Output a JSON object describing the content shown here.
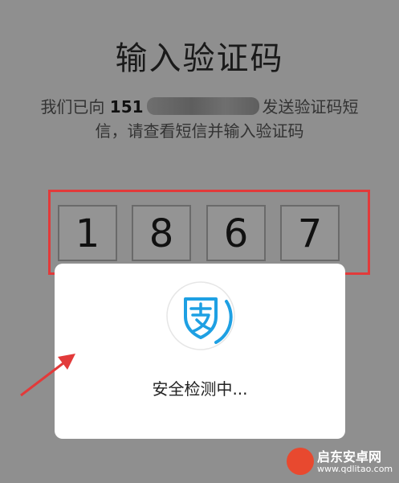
{
  "header": {
    "title": "输入验证码",
    "subtitle_prefix": "我们已向",
    "phone_visible": "151",
    "subtitle_suffix": "发送验证码短",
    "subtitle_line2": "信，请查看短信并输入验证码"
  },
  "code": {
    "digits": [
      "1",
      "8",
      "6",
      "7"
    ]
  },
  "dialog": {
    "icon": "alipay-shield-icon",
    "status_text": "安全检测中..."
  },
  "annotation": {
    "highlight_color": "#e23a3a",
    "arrow_color": "#e23a3a"
  },
  "watermark": {
    "title": "启东安卓网",
    "url": "www.qdlitao.com"
  }
}
